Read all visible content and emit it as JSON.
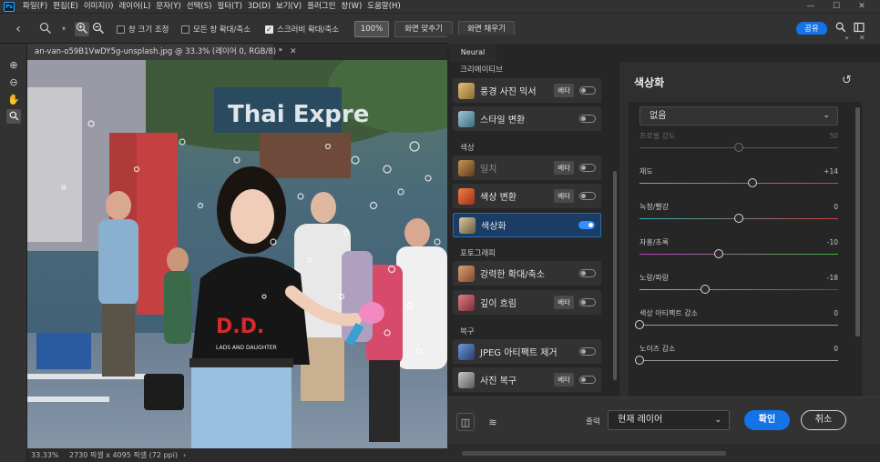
{
  "menubar": {
    "logo": "Ps",
    "items": [
      "파일(F)",
      "편집(E)",
      "이미지(I)",
      "레이어(L)",
      "문자(Y)",
      "선택(S)",
      "필터(T)",
      "3D(D)",
      "보기(V)",
      "플러그인",
      "창(W)",
      "도움말(H)"
    ],
    "minimize": "—",
    "maximize": "☐",
    "close": "✕"
  },
  "options": {
    "resize_windows": "창 크기 조정",
    "zoom_all": "모든 창 확대/축소",
    "scrubby_zoom": "스크러비 확대/축소",
    "zoom_100": "100%",
    "fit_screen": "화면 맞추기",
    "fill_screen": "화면 채우기",
    "share": "공유"
  },
  "document": {
    "tab_title": "an-van-o59B1VwDY5g-unsplash.jpg @ 33.3% (레이어 0, RGB/8) *",
    "zoom": "33.33%",
    "info": "2730 픽셀 x 4095 픽셀 (72 ppi)",
    "store_sign": "Thai Expre",
    "shirt_text": "D.D.",
    "shirt_sub": "LADS AND DAUGHTER"
  },
  "neural_filters": {
    "tab": "Neural Filters",
    "categories": [
      {
        "name": "크리에이티브",
        "filters": [
          {
            "name": "풍경 사진 믹서",
            "beta": "베타",
            "on": false,
            "dim": false,
            "color": "#c59b52"
          },
          {
            "name": "스타일 변환",
            "beta": "",
            "on": false,
            "dim": false,
            "color": "#5e8a9c"
          }
        ]
      },
      {
        "name": "색상",
        "filters": [
          {
            "name": "일치",
            "beta": "베타",
            "on": false,
            "dim": true,
            "color": "#8d6a3a"
          },
          {
            "name": "색상 변환",
            "beta": "베타",
            "on": false,
            "dim": false,
            "color": "#c45a2e"
          },
          {
            "name": "색상화",
            "beta": "",
            "on": true,
            "dim": false,
            "color": "#9d8a6a",
            "selected": true
          }
        ]
      },
      {
        "name": "포토그래피",
        "filters": [
          {
            "name": "강력한 확대/축소",
            "beta": "",
            "on": false,
            "dim": false,
            "color": "#c08050"
          },
          {
            "name": "깊이 흐림",
            "beta": "베타",
            "on": false,
            "dim": false,
            "color": "#b85a5a"
          }
        ]
      },
      {
        "name": "복구",
        "filters": [
          {
            "name": "JPEG 아티팩트 제거",
            "beta": "",
            "on": false,
            "dim": false,
            "color": "#4a6aa0"
          },
          {
            "name": "사진 복구",
            "beta": "베타",
            "on": false,
            "dim": false,
            "color": "#8a8a8a"
          }
        ]
      }
    ],
    "panel_title": "색상화",
    "profile": "없음",
    "sliders": [
      {
        "label": "프로필 강도",
        "value": "50",
        "pos": 0.5,
        "dim": true,
        "track": "#555555"
      },
      {
        "label": "채도",
        "value": "+14",
        "pos": 0.57,
        "dim": false,
        "track": "#9a9a9a-#d04040"
      },
      {
        "label": "녹청/빨강",
        "value": "0",
        "pos": 0.5,
        "dim": false,
        "track": "#30b0b0-#d04040"
      },
      {
        "label": "자홍/초록",
        "value": "-10",
        "pos": 0.4,
        "dim": false,
        "track": "#c040c0-#40b040"
      },
      {
        "label": "노랑/파랑",
        "value": "-18",
        "pos": 0.33,
        "dim": false,
        "track": "#c0b030-#4040c0"
      },
      {
        "label": "색상 아티팩트 감소",
        "value": "0",
        "pos": 0.0,
        "dim": false,
        "track": "#9a9a9a"
      },
      {
        "label": "노이즈 감소",
        "value": "0",
        "pos": 0.0,
        "dim": false,
        "track": "#9a9a9a"
      }
    ],
    "output_label": "출력",
    "output_value": "현재 레이어",
    "ok": "확인",
    "cancel": "취소"
  }
}
